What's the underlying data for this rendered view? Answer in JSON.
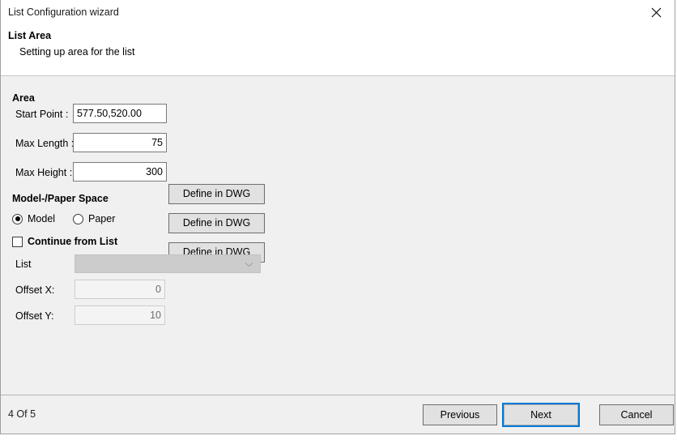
{
  "window": {
    "title": "List Configuration wizard",
    "close_icon": "close-icon"
  },
  "header": {
    "title": "List Area",
    "subtitle": "Setting up area for the list"
  },
  "area_section": {
    "title": "Area",
    "fields": [
      {
        "label": "Start Point :",
        "value": "577.50,520.00",
        "button": "Define in DWG"
      },
      {
        "label": "Max Length :",
        "value": "75",
        "button": "Define in DWG"
      },
      {
        "label": "Max Height :",
        "value": "300",
        "button": "Define in DWG"
      }
    ]
  },
  "space_section": {
    "title": "Model-/Paper Space",
    "options": [
      {
        "label": "Model",
        "selected": true
      },
      {
        "label": "Paper",
        "selected": false
      }
    ]
  },
  "continue_section": {
    "checkbox_label": "Continue from List",
    "checked": false,
    "list_label": "List",
    "list_value": "",
    "offset_x_label": "Offset X:",
    "offset_x_value": "0",
    "offset_y_label": "Offset Y:",
    "offset_y_value": "10"
  },
  "footer": {
    "status": "4 Of 5",
    "previous_label": "Previous",
    "next_label": "Next",
    "cancel_label": "Cancel",
    "focus_color": "#0078d7"
  }
}
